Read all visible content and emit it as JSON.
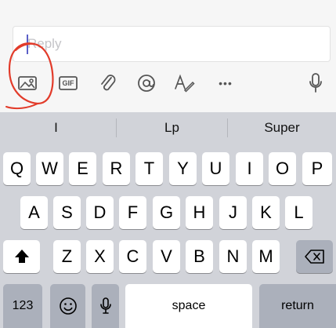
{
  "reply": {
    "placeholder": "Reply"
  },
  "toolbar": {
    "icons": [
      "image-icon",
      "gif-icon",
      "attachment-icon",
      "mention-icon",
      "format-icon",
      "more-icon",
      "microphone-icon"
    ],
    "gif_label": "GIF",
    "more_label": "•••"
  },
  "annotation": {
    "color": "#e23b2a"
  },
  "suggestions": [
    "I",
    "Lp",
    "Super"
  ],
  "keyboard": {
    "row1": [
      "Q",
      "W",
      "E",
      "R",
      "T",
      "Y",
      "U",
      "I",
      "O",
      "P"
    ],
    "row2": [
      "A",
      "S",
      "D",
      "F",
      "G",
      "H",
      "J",
      "K",
      "L"
    ],
    "row3": [
      "Z",
      "X",
      "C",
      "V",
      "B",
      "N",
      "M"
    ],
    "numbers_label": "123",
    "space_label": "space",
    "return_label": "return"
  },
  "colors": {
    "keyboard_bg": "#d1d3d9",
    "key_bg": "#ffffff",
    "dark_key_bg": "#abb0bb",
    "caret": "#5b5fc7"
  }
}
